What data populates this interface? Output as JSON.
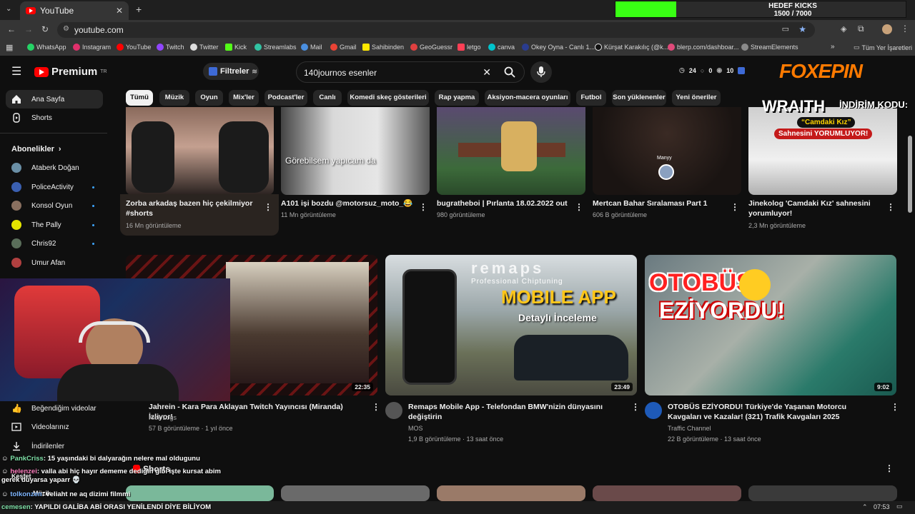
{
  "browser": {
    "tab_title": "YouTube",
    "url": "youtube.com",
    "bookmarks": [
      "WhatsApp",
      "Instagram",
      "YouTube",
      "Twitch",
      "Twitter",
      "Kick",
      "Streamlabs",
      "Mail",
      "Gmail",
      "Sahibinden",
      "GeoGuessr",
      "letgo",
      "canva",
      "Okey Oyna - Canlı 1...",
      "Kürşat Karakılıç (@k...",
      "blerp.com/dashboar...",
      "StreamElements"
    ],
    "all_bookmarks": "Tüm Yer İşaretleri"
  },
  "goal_widget": {
    "title": "HEDEF KICKS",
    "progress_text": "1500 / 7000",
    "progress": 0.21,
    "fill_color": "#39ff14"
  },
  "header": {
    "brand": "Premium",
    "brand_sup": "TR",
    "filters_label": "Filtreler",
    "search_value": "140journos esenler",
    "stats": [
      "24",
      "0",
      "10"
    ],
    "overlay_brand": "FOXEPIN",
    "overlay_promo": "İNDİRİM KODU:",
    "overlay_game": "WRAITH"
  },
  "chips": [
    "Tümü",
    "Müzik",
    "Oyun",
    "Mix'ler",
    "Podcast'ler",
    "Canlı",
    "Komedi skeç gösterileri",
    "Rap yapma",
    "Aksiyon-macera oyunları",
    "Futbol",
    "Son yüklenenler",
    "Yeni öneriler"
  ],
  "sidebar": {
    "home": "Ana Sayfa",
    "shorts": "Shorts",
    "subs_header": "Abonelikler",
    "subs": [
      "Ataberk Doğan",
      "PoliceActivity",
      "Konsol Oyun",
      "The Pally",
      "Chris92",
      "Umur Afan"
    ],
    "liked": "Beğendiğim videolar",
    "your_videos": "Videolarınız",
    "downloads": "İndirilenler",
    "explore": "Keşfet",
    "music": "Müzik"
  },
  "row1": [
    {
      "title": "Zorba arkadaş bazen hiç çekilmiyor #shorts",
      "meta": "16 Mn görüntüleme"
    },
    {
      "title": "A101 işi bozdu @motorsuz_moto_😂",
      "meta": "11 Mn görüntüleme",
      "overlay": "Görebilsem yapıcam da"
    },
    {
      "title": "bugratheboi | Pırlanta 18.02.2022 out",
      "meta": "980 görüntüleme"
    },
    {
      "title": "Mertcan Bahar Sıralaması Part 1",
      "meta": "606 B görüntüleme",
      "overlay": "Manyy"
    },
    {
      "title": "Jinekolog 'Camdaki Kız' sahnesini yorumluyor!",
      "meta": "2,3 Mn görüntüleme",
      "overlay1": "“Camdaki Kız”",
      "overlay2": "Sahnesini YORUMLUYOR!"
    }
  ],
  "row2": [
    {
      "title": "Jahrein - Kara Para Aklayan Twitch Yayıncısı (Miranda) İzliyor!",
      "channel": "Kick Logs",
      "meta": "57 B görüntüleme · 1 yıl önce",
      "duration": "22:35"
    },
    {
      "title": "Remaps Mobile App - Telefondan BMW'nizin dünyasını değiştirin",
      "channel": "MOS",
      "meta": "1,9 B görüntüleme · 13 saat önce",
      "duration": "23:49",
      "overlay1": "MOBILE APP",
      "overlay2": "Detaylı İnceleme",
      "overlay3": "Professional Chiptuning",
      "overlay_brand": "remaps"
    },
    {
      "title": "OTOBÜS EZİYORDU! Türkiye'de Yaşanan Motorcu Kavgaları ve Kazalar! (321) Trafik Kavgaları 2025",
      "channel": "Traffic Channel",
      "meta": "22 B görüntüleme · 13 saat önce",
      "duration": "9:02",
      "overlay1": "OTOBÜS",
      "overlay2": "EZİYORDU!"
    }
  ],
  "shorts_label": "Shorts",
  "chat": [
    {
      "user": "PankCriss",
      "text": ": 15 yaşındaki bi dalyarağın nelere mal oldugunu"
    },
    {
      "user": "helenzei",
      "text": ": valla abi hiç hayır dememe dediğin gibi işte kursat abim gerek duyarsa yaparr 💀"
    },
    {
      "user": "tolkonzen",
      "text": ": veliaht ne aq dizimi filmmi"
    },
    {
      "user": "cemesen",
      "text": ": YAPILDI GALİBA ABİ ORASI YENİLENDİ DİYE BİLİYOM"
    }
  ],
  "taskbar": {
    "time": "07:53"
  }
}
